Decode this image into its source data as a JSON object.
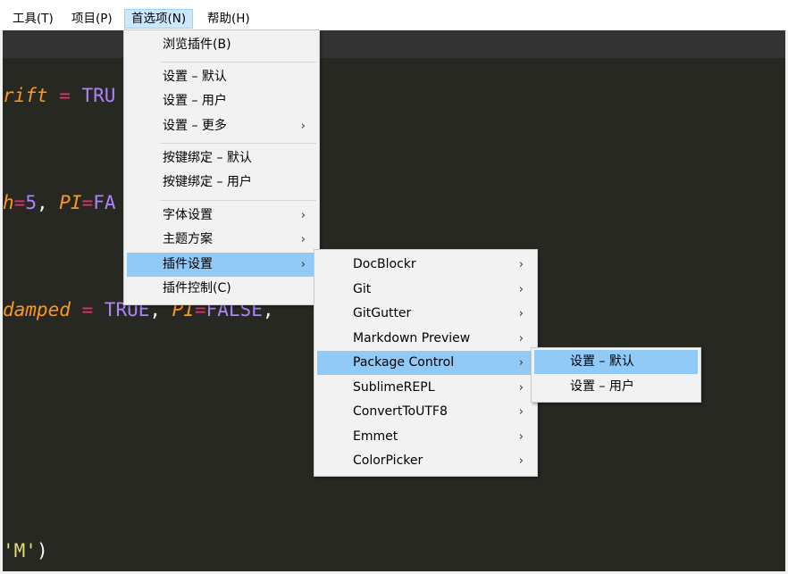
{
  "menubar": {
    "items": [
      "工具(T)",
      "项目(P)",
      "首选项(N)",
      "帮助(H)"
    ],
    "active": "首选项(N)"
  },
  "editor": {
    "lines": [
      {
        "parts": [
          "rift",
          " = ",
          "TRU"
        ]
      },
      {
        "parts": [
          "h",
          "=",
          "5",
          ", ",
          "PI",
          "=",
          "FA"
        ]
      },
      {
        "parts": [
          "damped",
          " = ",
          "TRUE",
          ", ",
          "PI",
          "=",
          "FALSE",
          ","
        ]
      },
      {
        "parts": [
          "'M'",
          ")"
        ]
      }
    ]
  },
  "preferences_menu": {
    "items": [
      "浏览插件(B)",
      "设置 – 默认",
      "设置 – 用户",
      "设置 – 更多",
      "按键绑定 – 默认",
      "按键绑定 – 用户",
      "字体设置",
      "主题方案",
      "插件设置",
      "插件控制(C)"
    ],
    "highlighted": "插件设置"
  },
  "plugin_settings_menu": {
    "items": [
      "DocBlockr",
      "Git",
      "GitGutter",
      "Markdown Preview",
      "Package Control",
      "SublimeREPL",
      "ConvertToUTF8",
      "Emmet",
      "ColorPicker"
    ],
    "highlighted": "Package Control"
  },
  "package_control_menu": {
    "items": [
      "设置 – 默认",
      "设置 – 用户"
    ],
    "highlighted": "设置 – 默认"
  },
  "colors": {
    "highlight": "#91c9f7",
    "editor_bg": "#272822"
  }
}
